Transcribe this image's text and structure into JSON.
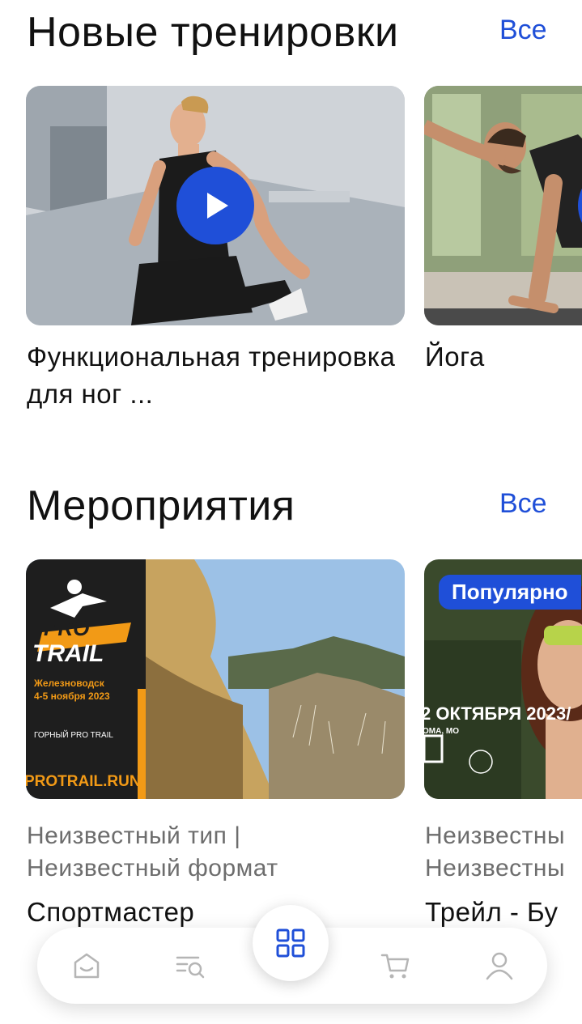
{
  "workouts": {
    "title": "Новые тренировки",
    "see_all": "Все",
    "cards": [
      {
        "title": "Функциональная тренировка для ног ..."
      },
      {
        "title": "Йога"
      }
    ]
  },
  "events": {
    "title": "Мероприятия",
    "see_all": "Все",
    "cards": [
      {
        "poster": {
          "brand_top": "PRO",
          "brand_bottom": "TRAIL",
          "location": "Железноводск",
          "dates": "4-5 ноября 2023",
          "subtitle": "ГОРНЫЙ PRO TRAIL",
          "site": "PROTRAIL.RUN"
        },
        "meta_line1": "Неизвестный тип |",
        "meta_line2": "Неизвестный формат",
        "title": "Спортмастер"
      },
      {
        "badge": "Популярно",
        "poster": {
          "date": "2 ОКТЯБРЯ 2023/",
          "place": "ОМА, МО"
        },
        "meta_line1": "Неизвестны",
        "meta_line2": "Неизвестны",
        "title": "Трейл - Бу"
      }
    ]
  },
  "tabbar": {
    "items": [
      "home-icon",
      "catalog-search-icon",
      "grid-icon",
      "cart-icon",
      "profile-icon"
    ]
  },
  "colors": {
    "accent": "#1f4fd8",
    "text": "#111111",
    "muted": "#6d6d6d"
  }
}
